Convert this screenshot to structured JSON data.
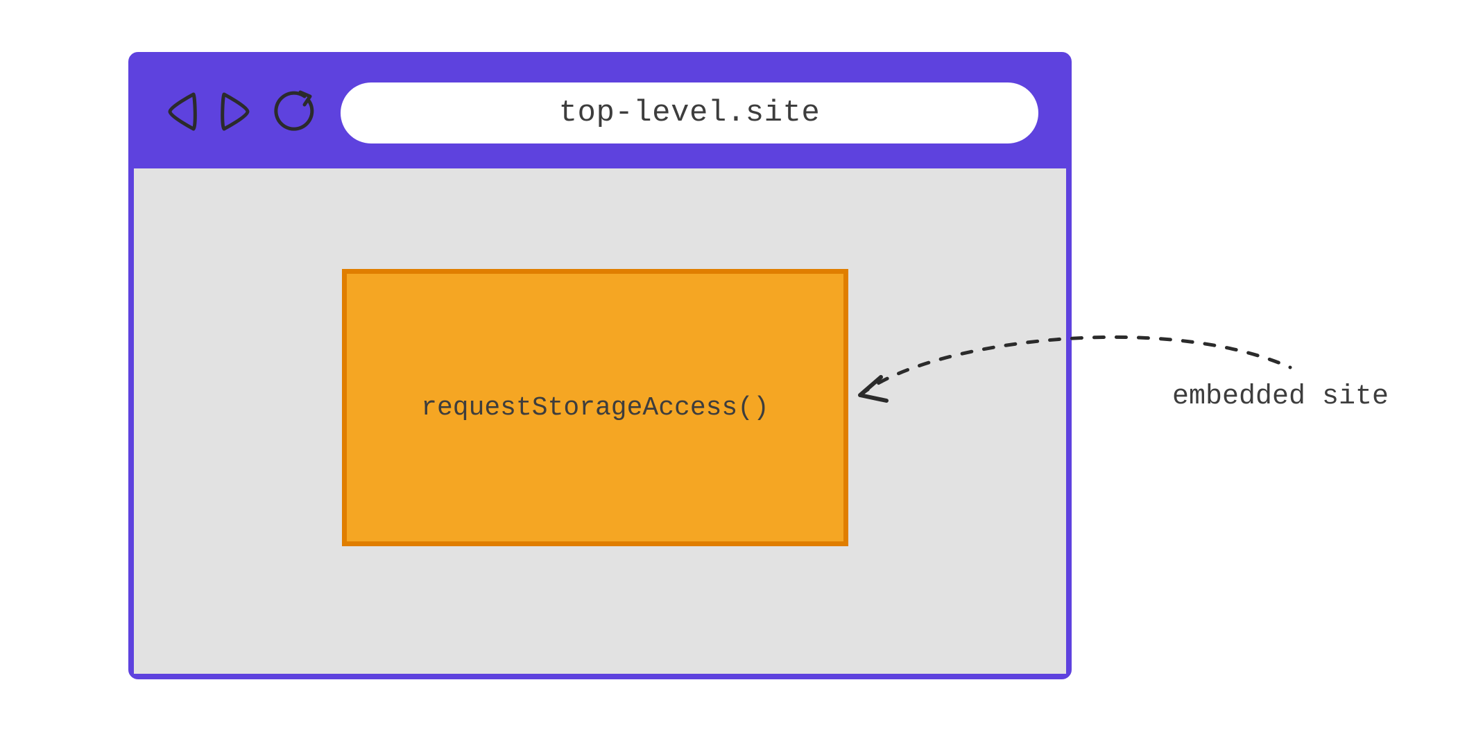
{
  "address_bar": {
    "url": "top-level.site"
  },
  "embedded_site": {
    "api_call": "requestStorageAccess()"
  },
  "annotation": {
    "label": "embedded site"
  },
  "icons": {
    "back": "back-icon",
    "forward": "forward-icon",
    "reload": "reload-icon"
  },
  "colors": {
    "browser_chrome": "#5E42DE",
    "viewport_bg": "#e2e2e2",
    "iframe_fill": "#F5A623",
    "iframe_border": "#E07E00"
  }
}
